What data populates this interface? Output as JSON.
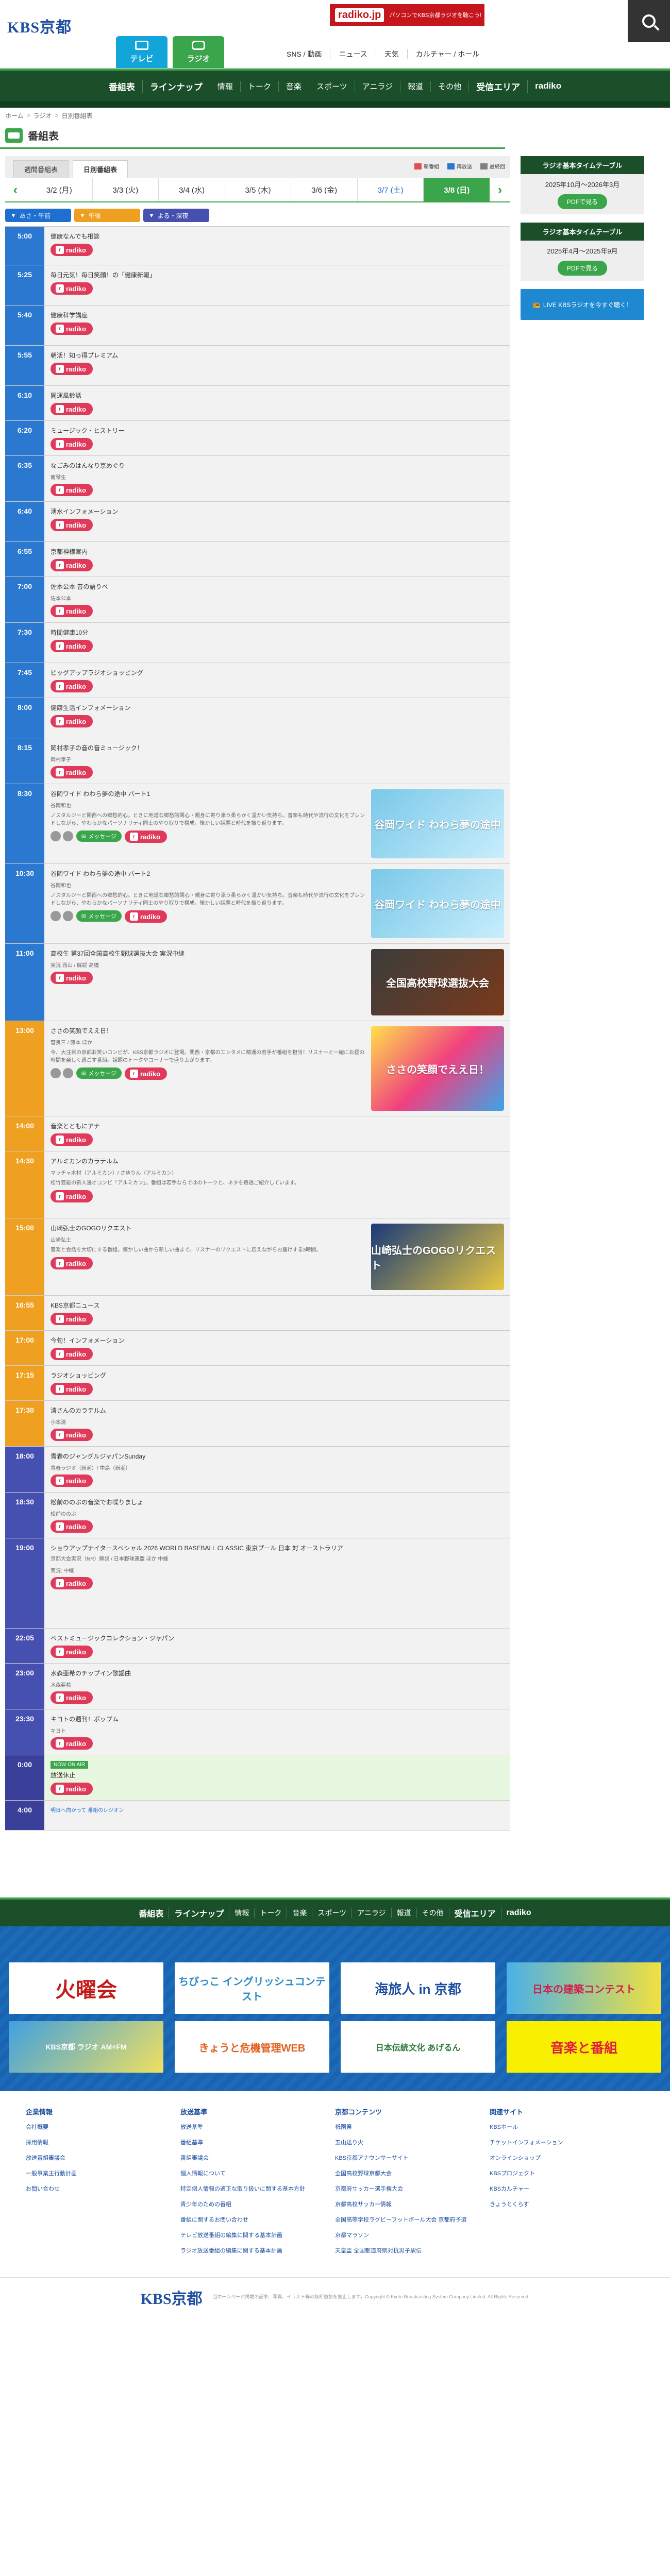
{
  "header": {
    "logo": "KBS京都",
    "tabs": [
      {
        "label": "テレビ"
      },
      {
        "label": "ラジオ"
      }
    ],
    "banner_logo": "radiko.jp",
    "banner_text": "パソコンでKBS京都ラジオを聴こう!",
    "links": [
      "SNS / 動画",
      "ニュース",
      "天気",
      "カルチャー / ホール"
    ]
  },
  "nav": [
    "番組表",
    "ラインナップ",
    "情報",
    "トーク",
    "音楽",
    "スポーツ",
    "アニラジ",
    "報道",
    "その他",
    "受信エリア",
    "radiko"
  ],
  "breadcrumb": [
    "ホーム",
    "ラジオ",
    "日別番組表"
  ],
  "page_title": "番組表",
  "tabs": [
    "週間番組表",
    "日別番組表"
  ],
  "legend": [
    {
      "label": "新番組",
      "color": "#e05050"
    },
    {
      "label": "再放送",
      "color": "#2a78d0"
    },
    {
      "label": "最終回",
      "color": "#808080"
    }
  ],
  "days": [
    "3/2 (月)",
    "3/3 (火)",
    "3/4 (水)",
    "3/5 (木)",
    "3/6 (金)",
    "3/7 (土)",
    "3/8 (日)"
  ],
  "periods": [
    "あさ・午前",
    "午後",
    "よる・深夜"
  ],
  "radiko_label": "radiko",
  "message_label": "メッセージ",
  "onair_label": "NOW ON AIR",
  "programs": [
    {
      "time": "5:00",
      "period": "morning",
      "title": "健康なんでも相談",
      "performer": "",
      "desc": ""
    },
    {
      "time": "5:25",
      "period": "morning",
      "title": "毎日元気！毎日笑顔！の「健康新報」",
      "performer": "",
      "desc": ""
    },
    {
      "time": "5:40",
      "period": "morning",
      "title": "健康科学講座",
      "performer": "",
      "desc": ""
    },
    {
      "time": "5:55",
      "period": "morning",
      "title": "朝活！知っ得プレミアム",
      "performer": "",
      "desc": ""
    },
    {
      "time": "6:10",
      "period": "morning",
      "title": "開運風鈴話",
      "performer": "",
      "desc": ""
    },
    {
      "time": "6:20",
      "period": "morning",
      "title": "ミュージック・ヒストリー",
      "performer": "",
      "desc": ""
    },
    {
      "time": "6:35",
      "period": "morning",
      "title": "なごみのはんなり京めぐり",
      "performer": "南琴生",
      "desc": ""
    },
    {
      "time": "6:40",
      "period": "morning",
      "title": "湧水インフォメーション",
      "performer": "",
      "desc": ""
    },
    {
      "time": "6:55",
      "period": "morning",
      "title": "京都神様案内",
      "performer": "",
      "desc": ""
    },
    {
      "time": "7:00",
      "period": "morning",
      "title": "佐本公本 音の語りべ",
      "performer": "佐本公本",
      "desc": ""
    },
    {
      "time": "7:30",
      "period": "morning",
      "title": "時間健康10分",
      "performer": "",
      "desc": ""
    },
    {
      "time": "7:45",
      "period": "morning",
      "title": "ビッグアップラジオショッピング",
      "performer": "",
      "desc": ""
    },
    {
      "time": "8:00",
      "period": "morning",
      "title": "健康生活インフォメーション",
      "performer": "",
      "desc": ""
    },
    {
      "time": "8:15",
      "period": "morning",
      "title": "岡村孝子の音の音ミュージック！",
      "performer": "岡村孝子",
      "desc": ""
    },
    {
      "time": "8:30",
      "period": "morning",
      "title": "谷岡ワイド わわら夢の途中 パート1",
      "performer": "谷岡和也",
      "desc": "ノスタルジーと関西への郷愁的心。ときに地道な郷愁的関心・親身に寄り添う柔らかく温かい気持ち。音楽も時代や流行の文化をブレンドしながら、やわらかなパーソナリティ同士のやり取りで構成。懐かしい話題と時代を振り返ります。",
      "thumb": "谷岡ワイド わわら夢の途中",
      "has_message": true
    },
    {
      "time": "10:30",
      "period": "morning",
      "title": "谷岡ワイド わわら夢の途中 パート2",
      "performer": "谷岡和也",
      "desc": "ノスタルジーと関西への郷愁的心。ときに地道な郷愁的関心・親身に寄り添う柔らかく温かい気持ち。音楽も時代や流行の文化をブレンドしながら、やわらかなパーソナリティ同士のやり取りで構成。懐かしい話題と時代を振り返ります。",
      "thumb": "谷岡ワイド わわら夢の途中",
      "has_message": true
    },
    {
      "time": "11:00",
      "period": "morning",
      "title": "高校生 第37回全国高校生野球選抜大会 実況中継",
      "performer": "実況 西山 / 解説 高橋",
      "desc": "",
      "thumb": "全国高校野球選抜大会"
    },
    {
      "time": "13:00",
      "period": "noon",
      "title": "ささの笑顔でええ日！",
      "performer": "菅良三 / 藤本 ほか",
      "desc": "今、大注目の京都お笑いコンビが、KBS京都ラジオに登場。関西・京都のエンタメに精通の若手が番組を担当！リスナーと一緒にお昼の時間を楽しく過ごす番組。話題のトークやコーナーで盛り上がります。",
      "thumb": "ささの笑顔でええ日！",
      "has_message": true
    },
    {
      "time": "14:00",
      "period": "noon",
      "title": "音楽とともにアナ",
      "performer": "",
      "desc": ""
    },
    {
      "time": "14:30",
      "period": "noon",
      "title": "アルミカンのカラテルム",
      "performer": "マッチャ木村（アルミカン）/ さゆりん（アルミカン）",
      "desc": "松竹芸能の新人漫才コンビ「アルミカン」。番組は若手ならではのトークと、ネタを毎週ご紹介しています。"
    },
    {
      "time": "15:00",
      "period": "noon",
      "title": "山崎弘士のGOGOリクエスト",
      "performer": "山崎弘士",
      "desc": "音楽と会話を大切にする番組。懐かしい曲から新しい曲まで、リスナーのリクエストに応えながらお届けする3時間。",
      "thumb": "山崎弘士のGOGOリクエスト"
    },
    {
      "time": "16:55",
      "period": "noon",
      "title": "KBS京都ニュース",
      "performer": "",
      "desc": ""
    },
    {
      "time": "17:00",
      "period": "noon",
      "title": "今旬！インフォメーション",
      "performer": "",
      "desc": ""
    },
    {
      "time": "17:15",
      "period": "noon",
      "title": "ラジオショッピング",
      "performer": "",
      "desc": ""
    },
    {
      "time": "17:30",
      "period": "noon",
      "title": "清さんのカラテルム",
      "performer": "小本清",
      "desc": ""
    },
    {
      "time": "18:00",
      "period": "night",
      "title": "青春のジャングルジャパンSunday",
      "performer": "青春ラジオ（新潮）/ 中島（新潮）",
      "desc": ""
    },
    {
      "time": "18:30",
      "period": "night",
      "title": "松前ののぶの音楽でお喋りましょ",
      "performer": "松前ののぶ",
      "desc": ""
    },
    {
      "time": "19:00",
      "period": "night",
      "title": "ショウアップナイタースペシャル 2026 WORLD BASEBALL CLASSIC 東京プール 日本 対 オーストラリア",
      "performer": "",
      "desc": "京都大会実況（NR）解説 / 日本野球連盟 ほか 中継",
      "note": "実況: 中継"
    },
    {
      "time": "22:05",
      "period": "night",
      "title": "ベストミュージックコレクション・ジャパン",
      "performer": "",
      "desc": ""
    },
    {
      "time": "23:00",
      "period": "night",
      "title": "水森亜希のチップイン歌謡曲",
      "performer": "水森亜希",
      "desc": ""
    },
    {
      "time": "23:30",
      "period": "night",
      "title": "キヨトの週刊！ポップム",
      "performer": "キヨト",
      "desc": ""
    },
    {
      "time": "0:00",
      "period": "late",
      "title": "放送休止",
      "performer": "",
      "desc": "",
      "onair": true
    },
    {
      "time": "4:00",
      "period": "late",
      "title": "明日へ向かって 番組のレジオン",
      "performer": "",
      "desc": "",
      "link_only": true
    }
  ],
  "sidebar": {
    "boxes": [
      {
        "title": "ラジオ基本タイムテーブル",
        "period": "2025年10月〜2026年3月",
        "button": "PDFで見る"
      },
      {
        "title": "ラジオ基本タイムテーブル",
        "period": "2025年4月〜2025年9月",
        "button": "PDFで見る"
      }
    ],
    "live_banner": "LIVE KBSラジオを今すぐ聴く！"
  },
  "footer_banners": [
    "火曜会",
    "ちびっこ イングリッシュコンテスト",
    "海旅人 in 京都",
    "日本の建築コンテスト",
    "KBS京都 ラジオ AM+FM",
    "きょうと危機管理WEB",
    "日本伝統文化 あげるん",
    "音楽と番組"
  ],
  "footer_cols": [
    {
      "title": "企業情報",
      "items": [
        "会社概要",
        "採用情報",
        "放送番組審議会",
        "一般事業主行動計画",
        "お問い合わせ"
      ]
    },
    {
      "title": "放送基準",
      "items": [
        "放送基準",
        "番組基準",
        "番組審議会",
        "個人情報について",
        "特定個人情報の適正な取り扱いに関する基本方針",
        "青少年のための番組",
        "番組に関するお問い合わせ",
        "テレビ放送番組の編集に関する基本計画",
        "ラジオ放送番組の編集に関する基本計画"
      ]
    },
    {
      "title": "京都コンテンツ",
      "items": [
        "祇園祭",
        "五山送り火",
        "KBS京都アナウンサーサイト",
        "全国高校野球京都大会",
        "京都府サッカー選手権大会",
        "京都高校サッカー情報",
        "全国高等学校ラグビーフットボール大会 京都府予選",
        "京都マラソン",
        "天皇盃 全国都道府県対抗男子駅伝"
      ]
    },
    {
      "title": "関連サイト",
      "items": [
        "KBSホール",
        "チケットインフォメーション",
        "オンラインショップ",
        "KBSプロジェクト",
        "KBSカルチャー",
        "きょうとくらす"
      ]
    }
  ],
  "footer_logo": "KBS京都",
  "copyright": "当ホームページ掲載の記事、写真、イラスト等の無断複製を禁止します。Copyright © Kyoto Broadcasting System Company Limited. All Rights Reserved."
}
